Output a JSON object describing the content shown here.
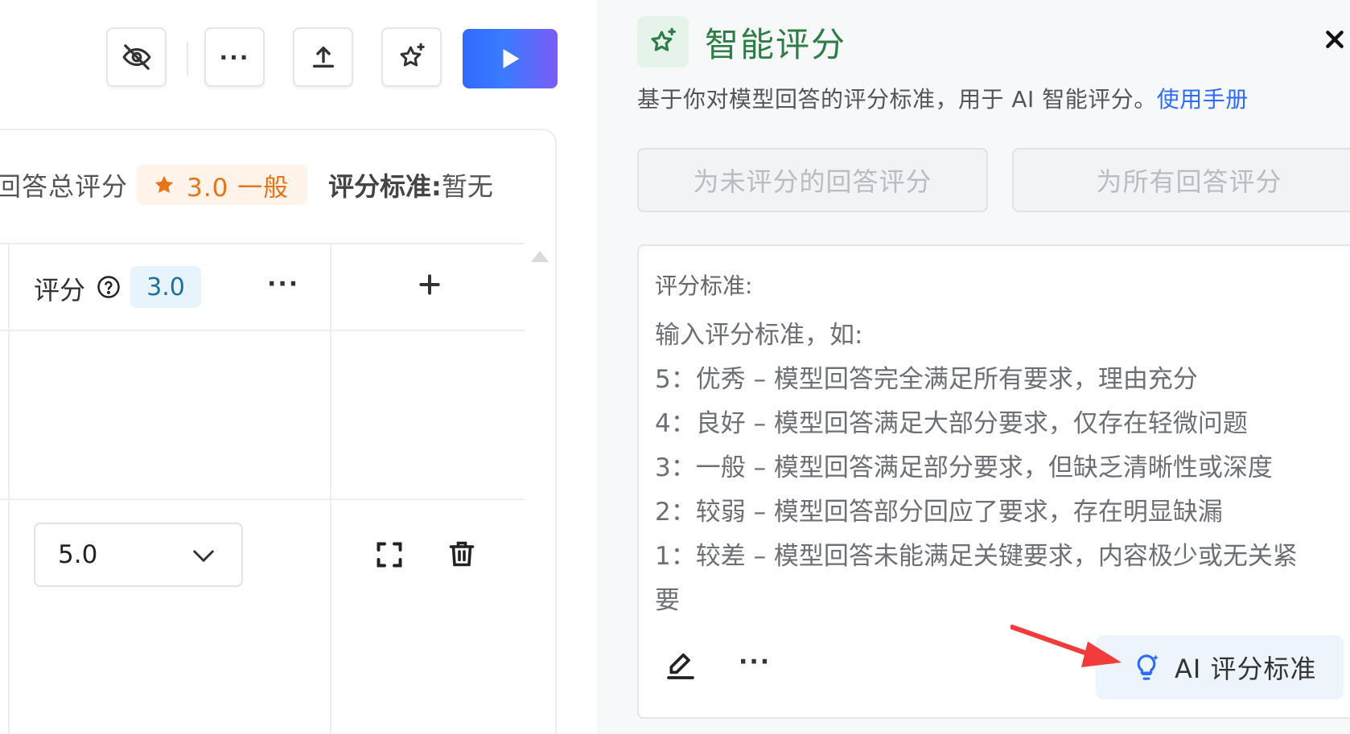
{
  "toolbar": {
    "buttons": [
      {
        "icon": "eye-off-icon"
      },
      {
        "icon": "more-icon",
        "glyph": "···"
      },
      {
        "icon": "upload-icon"
      },
      {
        "icon": "star-sparkle-icon"
      }
    ],
    "run_icon": "play-icon",
    "run_gradient": [
      "#2f6bff",
      "#7b5cf5"
    ]
  },
  "summary": {
    "label": "回答总评分",
    "score_text": "3.0 一般",
    "score_color": "#e8741a",
    "criteria_label": "评分标准:",
    "criteria_value": "暂无"
  },
  "column": {
    "title": "评分",
    "badge": "3.0",
    "more": "···"
  },
  "row": {
    "select_value": "5.0"
  },
  "panel": {
    "title": "智能评分",
    "title_color": "#2e7d46",
    "description": "基于你对模型回答的评分标准，用于 AI 智能评分。",
    "manual_link": "使用手册",
    "btn_unscored": "为未评分的回答评分",
    "btn_all": "为所有回答评分",
    "editor_label": "评分标准:",
    "editor_lines": [
      "输入评分标准，如:",
      "5：优秀 – 模型回答完全满足所有要求，理由充分",
      "4：良好 – 模型回答满足大部分要求，仅存在轻微问题",
      "3：一般 – 模型回答满足部分要求，但缺乏清晰性或深度",
      "2：较弱 – 模型回答部分回应了要求，存在明显缺漏",
      "1：较差 – 模型回答未能满足关键要求，内容极少或无关紧",
      "要"
    ],
    "editor_more": "···",
    "ai_button": "AI 评分标准"
  }
}
